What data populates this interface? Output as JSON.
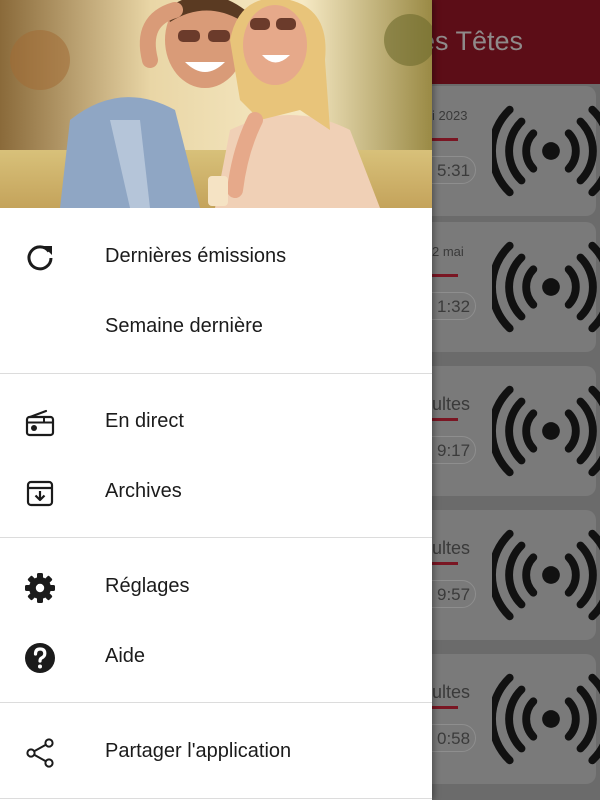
{
  "background_app": {
    "title": "es Têtes",
    "cards": [
      {
        "text": "i 2023",
        "text_size": "small",
        "duration": "5:31"
      },
      {
        "text": "2 mai",
        "text_size": "small",
        "duration": "1:32"
      },
      {
        "text": "ultes",
        "text_size": "big",
        "duration": "9:17"
      },
      {
        "text": "ultes",
        "text_size": "big",
        "duration": "9:57"
      },
      {
        "text": "ultes",
        "text_size": "big",
        "duration": "0:58"
      }
    ],
    "card_icon": "broadcast-icon"
  },
  "drawer": {
    "header_image": "couple-listening-music-photo",
    "sections": [
      {
        "items": [
          {
            "label": "Dernières émissions",
            "icon": "refresh-icon"
          },
          {
            "label": "Semaine dernière",
            "icon": ""
          }
        ]
      },
      {
        "items": [
          {
            "label": "En direct",
            "icon": "radio-icon"
          },
          {
            "label": "Archives",
            "icon": "archive-icon"
          }
        ]
      },
      {
        "items": [
          {
            "label": "Réglages",
            "icon": "gear-icon"
          },
          {
            "label": "Aide",
            "icon": "help-icon"
          }
        ]
      },
      {
        "items": [
          {
            "label": "Partager l'application",
            "icon": "share-icon"
          }
        ]
      }
    ]
  },
  "colors": {
    "app_bar": "#5c0d17",
    "accent_line": "#7a1623",
    "scrim": "#6b6b6b",
    "drawer_bg": "#ffffff"
  }
}
